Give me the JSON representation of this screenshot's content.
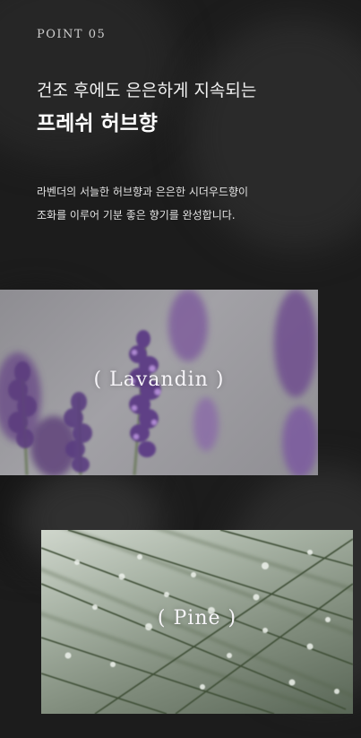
{
  "point_label": "POINT 05",
  "headline": {
    "line1": "건조 후에도 은은하게 지속되는",
    "line2": "프레쉬 허브향"
  },
  "description": {
    "line1": "라벤더의 서늘한 허브향과 은은한 시더우드향이",
    "line2": "조화를 이루어 기분 좋은 향기를 완성합니다."
  },
  "photos": [
    {
      "caption": "( Lavandin )",
      "subject": "lavender"
    },
    {
      "caption": "( Pine )",
      "subject": "pine-needles"
    }
  ]
}
